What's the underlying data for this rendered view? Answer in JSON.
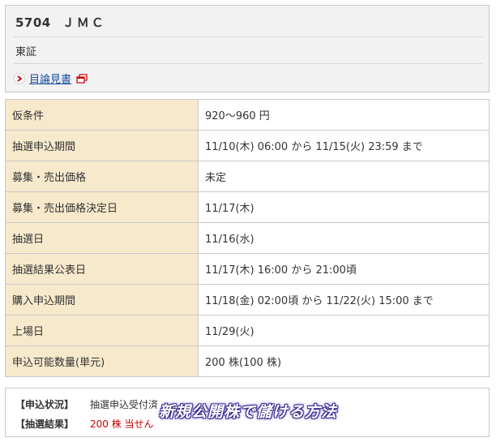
{
  "header": {
    "code": "5704",
    "name": "ＪＭＣ",
    "market": "東証",
    "prospectus_link": "目論見書"
  },
  "table": {
    "rows": [
      {
        "label": "仮条件",
        "value": "920～960 円"
      },
      {
        "label": "抽選申込期間",
        "value": "11/10(木) 06:00 から 11/15(火) 23:59 まで"
      },
      {
        "label": "募集・売出価格",
        "value": "未定"
      },
      {
        "label": "募集・売出価格決定日",
        "value": "11/17(木)"
      },
      {
        "label": "抽選日",
        "value": "11/16(水)"
      },
      {
        "label": "抽選結果公表日",
        "value": "11/17(木) 16:00 から 21:00頃"
      },
      {
        "label": "購入申込期間",
        "value": "11/18(金) 02:00頃 から 11/22(火) 15:00 まで"
      },
      {
        "label": "上場日",
        "value": "11/29(火)"
      },
      {
        "label": "申込可能数量(単元)",
        "value": "200 株(100 株)"
      }
    ]
  },
  "status": {
    "application_label": "【申込状況】",
    "application_value": "抽選申込受付済",
    "result_label": "【抽選結果】",
    "result_value": "200 株 当せん"
  },
  "watermark": "新規公開株で儲ける方法",
  "colors": {
    "label_bg": "#f7e9cc",
    "border": "#c8c8c8",
    "link": "#1a4fa0",
    "result_red": "#cc0000",
    "header_bg": "#f2f2f2"
  },
  "icons": {
    "prospectus_arrow": "chevron-right-icon",
    "prospectus_window": "new-window-icon"
  }
}
